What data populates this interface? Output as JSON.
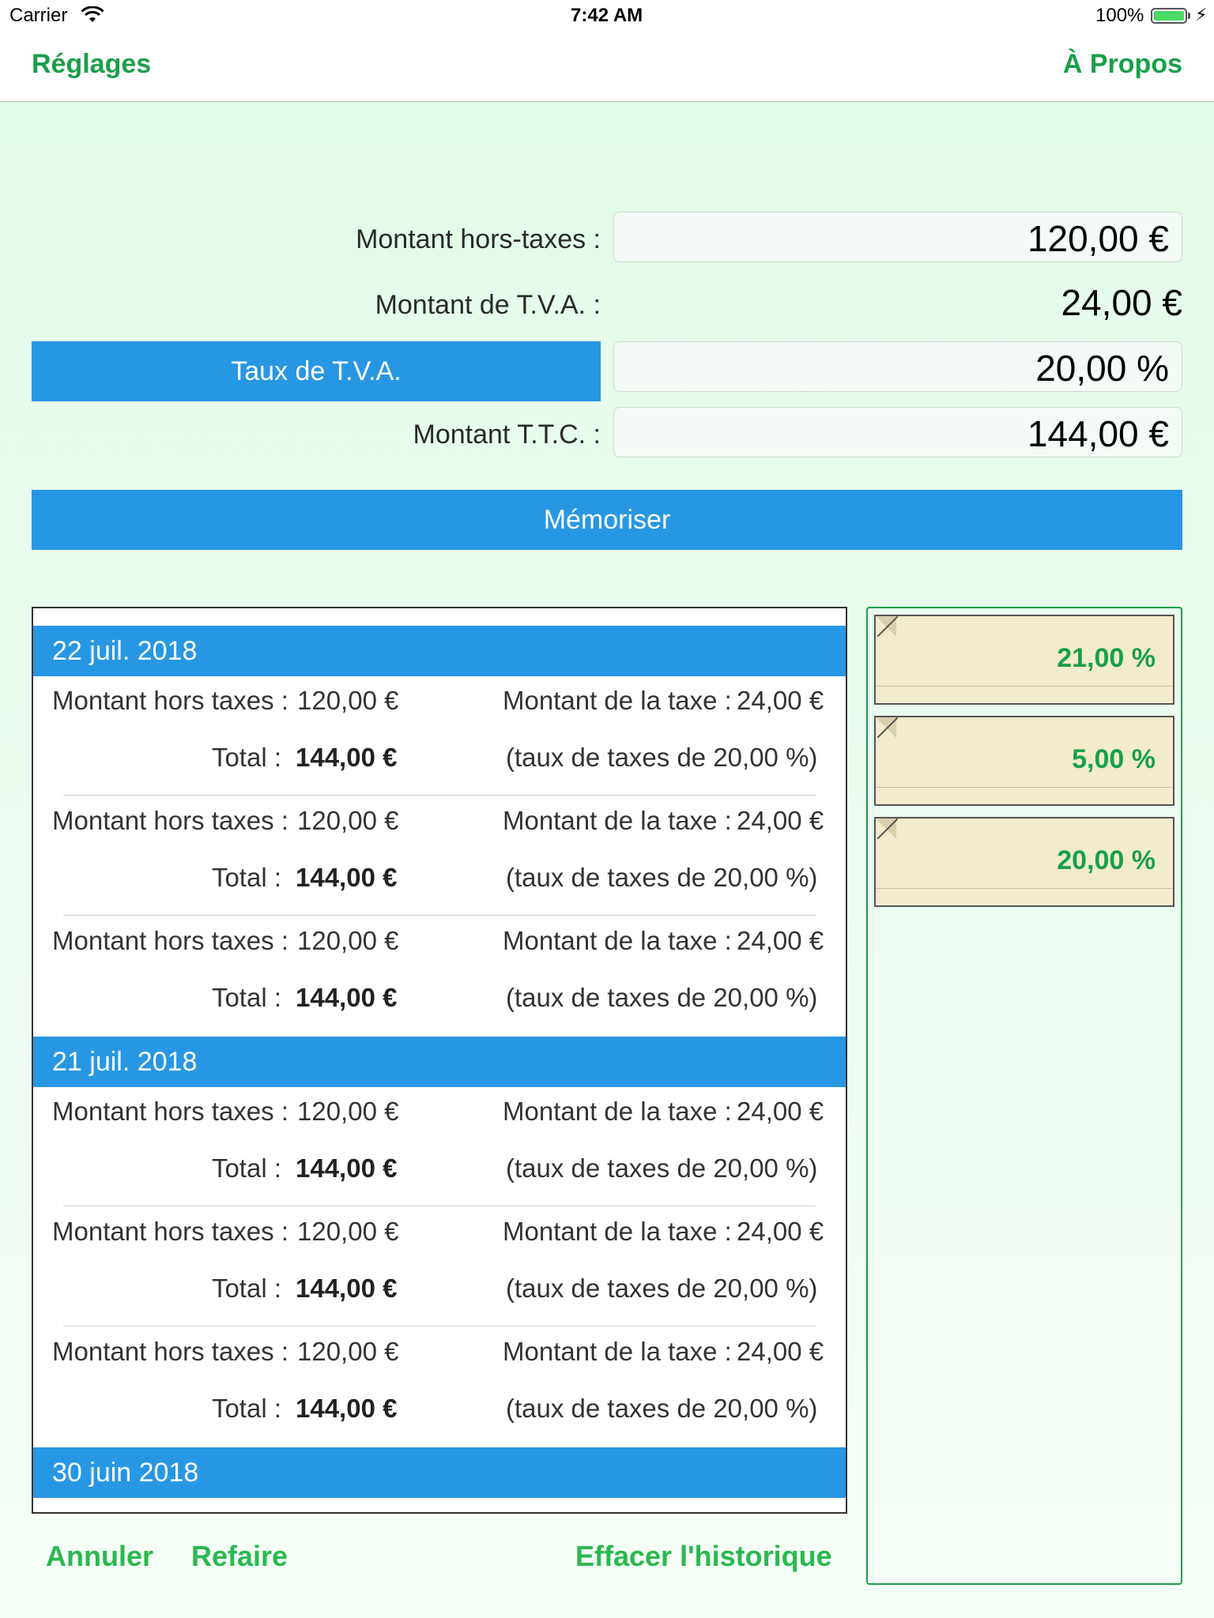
{
  "status_bar": {
    "carrier": "Carrier",
    "time": "7:42 AM",
    "battery": "100%",
    "wifi_icon": "wifi-icon",
    "battery_icon": "battery-icon",
    "charging_icon": "bolt-icon"
  },
  "nav": {
    "left_button": "Réglages",
    "right_button": "À Propos"
  },
  "form": {
    "ht_label": "Montant hors-taxes :",
    "ht_value": "120,00 €",
    "tva_label": "Montant de T.V.A. :",
    "tva_value": "24,00 €",
    "rate_button": "Taux de T.V.A.",
    "rate_value": "20,00 %",
    "ttc_label": "Montant T.T.C. :",
    "ttc_value": "144,00 €",
    "memo_button": "Mémoriser"
  },
  "history": {
    "sections": [
      {
        "date": "22 juil. 2018",
        "entries": [
          {
            "ht_label": "Montant hors taxes :",
            "ht_value": "120,00 €",
            "tax_label": "Montant de la taxe :",
            "tax_value": "24,00 €",
            "total_label": "Total :",
            "total_value": "144,00 €",
            "rate_note": "(taux de taxes de 20,00 %)"
          },
          {
            "ht_label": "Montant hors taxes :",
            "ht_value": "120,00 €",
            "tax_label": "Montant de la taxe :",
            "tax_value": "24,00 €",
            "total_label": "Total :",
            "total_value": "144,00 €",
            "rate_note": "(taux de taxes de 20,00 %)"
          },
          {
            "ht_label": "Montant hors taxes :",
            "ht_value": "120,00 €",
            "tax_label": "Montant de la taxe :",
            "tax_value": "24,00 €",
            "total_label": "Total :",
            "total_value": "144,00 €",
            "rate_note": "(taux de taxes de 20,00 %)"
          }
        ]
      },
      {
        "date": "21 juil. 2018",
        "entries": [
          {
            "ht_label": "Montant hors taxes :",
            "ht_value": "120,00 €",
            "tax_label": "Montant de la taxe :",
            "tax_value": "24,00 €",
            "total_label": "Total :",
            "total_value": "144,00 €",
            "rate_note": "(taux de taxes de 20,00 %)"
          },
          {
            "ht_label": "Montant hors taxes :",
            "ht_value": "120,00 €",
            "tax_label": "Montant de la taxe :",
            "tax_value": "24,00 €",
            "total_label": "Total :",
            "total_value": "144,00 €",
            "rate_note": "(taux de taxes de 20,00 %)"
          },
          {
            "ht_label": "Montant hors taxes :",
            "ht_value": "120,00 €",
            "tax_label": "Montant de la taxe :",
            "tax_value": "24,00 €",
            "total_label": "Total :",
            "total_value": "144,00 €",
            "rate_note": "(taux de taxes de 20,00 %)"
          }
        ]
      },
      {
        "date": "30 juin 2018",
        "entries": []
      }
    ]
  },
  "actions": {
    "undo": "Annuler",
    "redo": "Refaire",
    "clear_history": "Effacer l'historique"
  },
  "presets": [
    {
      "value": "21,00 %"
    },
    {
      "value": "5,00 %"
    },
    {
      "value": "20,00 %"
    }
  ],
  "colors": {
    "accent_blue": "#2897e3",
    "accent_green": "#1a9f4a",
    "button_green": "#2ab84f",
    "background": "#e3fbe9",
    "note_paper": "#f2ebce"
  }
}
